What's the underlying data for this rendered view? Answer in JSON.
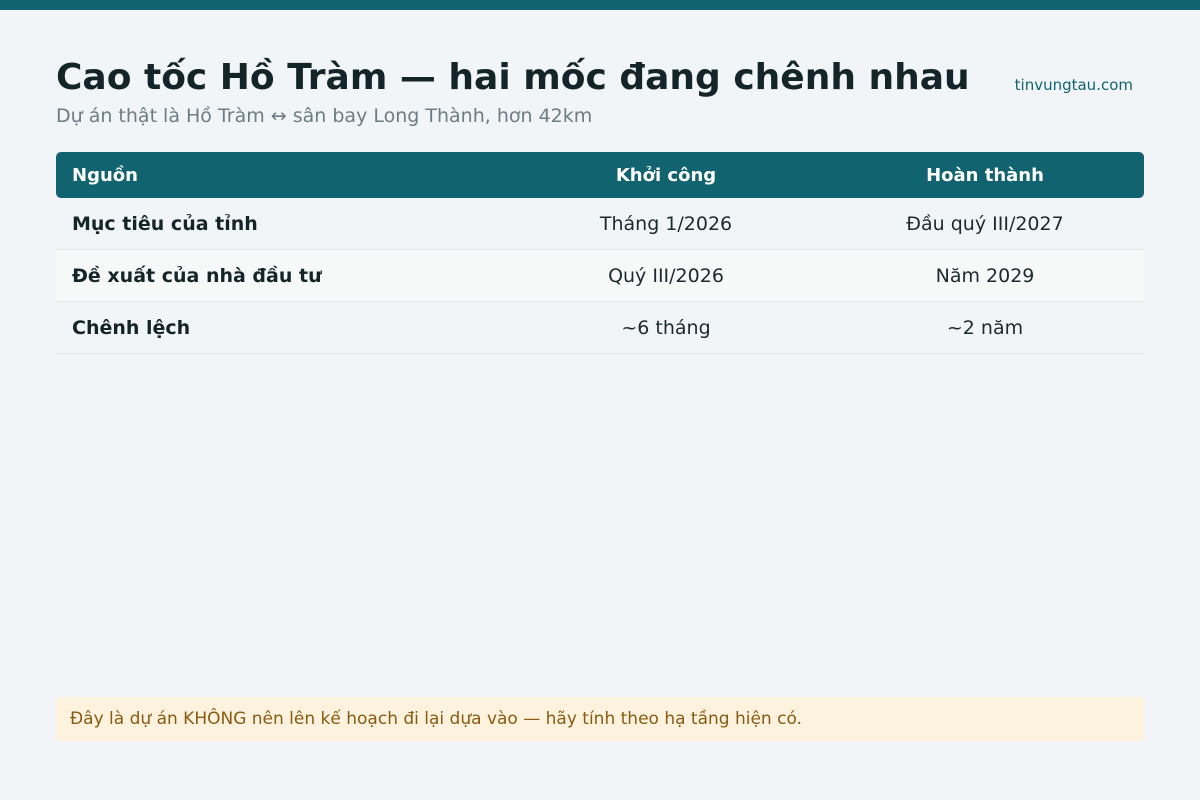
{
  "header": {
    "title": "Cao tốc Hồ Tràm — hai mốc đang chênh nhau",
    "subtitle": "Dự án thật là Hồ Tràm ↔ sân bay Long Thành, hơn 42km",
    "source": "tinvungtau.com"
  },
  "table": {
    "columns": [
      "Nguồn",
      "Khởi công",
      "Hoàn thành"
    ],
    "rows": [
      {
        "label": "Mục tiêu của tỉnh",
        "start": "Tháng 1/2026",
        "finish": "Đầu quý III/2027"
      },
      {
        "label": "Đề xuất của nhà đầu tư",
        "start": "Quý III/2026",
        "finish": "Năm 2029"
      },
      {
        "label": "Chênh lệch",
        "start": "~6 tháng",
        "finish": "~2 năm"
      }
    ]
  },
  "note": "Đây là dự án KHÔNG nên lên kế hoạch đi lại dựa vào — hãy tính theo hạ tầng hiện có.",
  "colors": {
    "accent": "#11636f",
    "background": "#f2f5f7",
    "note_background": "#fdf2de",
    "note_text": "#8a5a12"
  }
}
